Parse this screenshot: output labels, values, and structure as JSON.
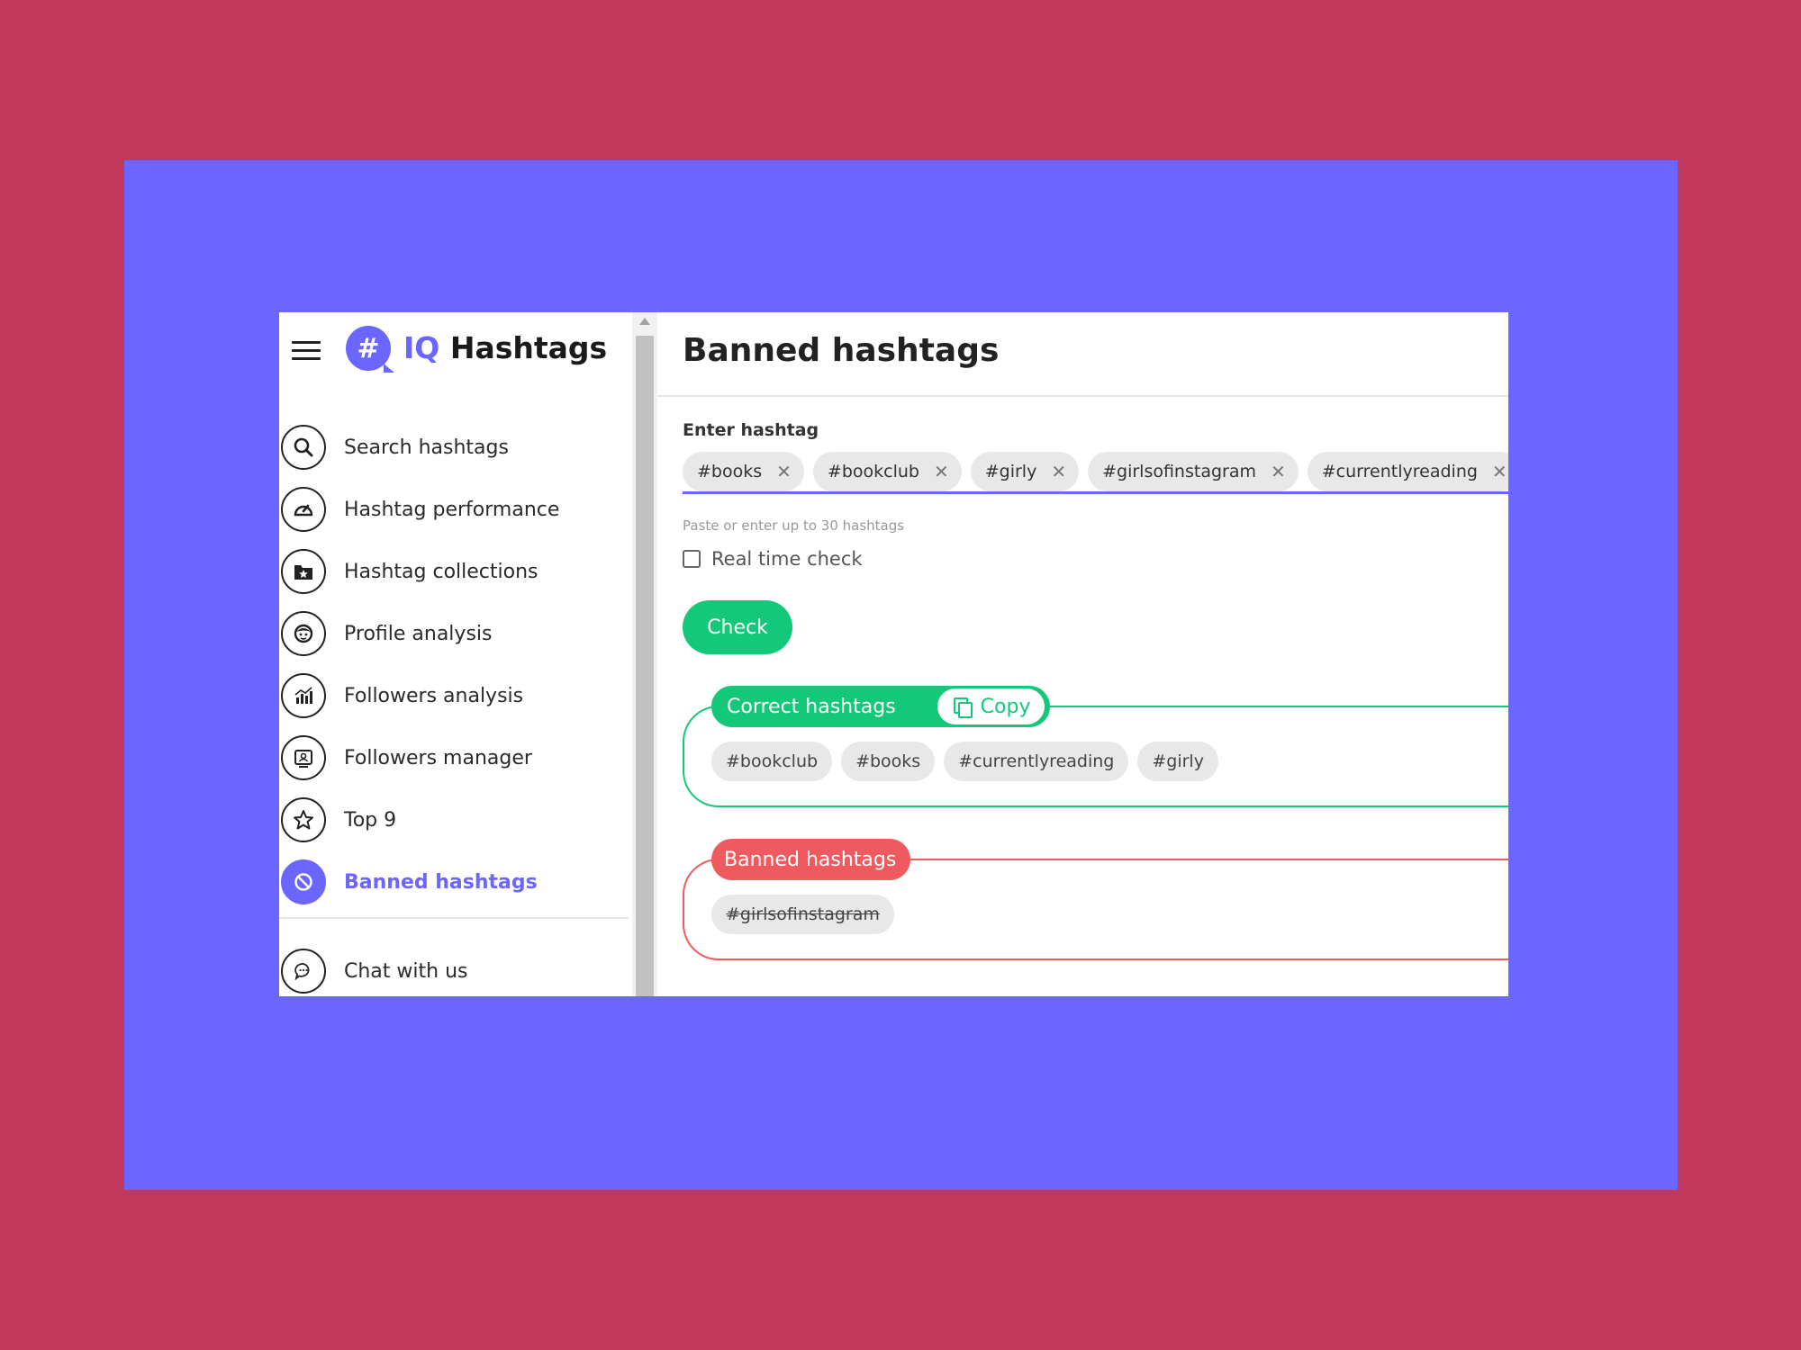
{
  "logo": {
    "badge": "#",
    "prefix": "IQ",
    "name": "Hashtags"
  },
  "colors": {
    "background": "#c0395d",
    "frame": "#6b66ff",
    "accent": "#6b66ff",
    "success": "#13c979",
    "danger": "#ef5a5f"
  },
  "sidebar": {
    "items": [
      {
        "label": "Search hashtags",
        "icon": "search-icon"
      },
      {
        "label": "Hashtag performance",
        "icon": "speedometer-icon"
      },
      {
        "label": "Hashtag collections",
        "icon": "folder-star-icon"
      },
      {
        "label": "Profile analysis",
        "icon": "face-icon"
      },
      {
        "label": "Followers analysis",
        "icon": "bar-chart-icon"
      },
      {
        "label": "Followers manager",
        "icon": "id-card-icon"
      },
      {
        "label": "Top 9",
        "icon": "star-icon"
      },
      {
        "label": "Banned hashtags",
        "icon": "block-icon",
        "active": true
      },
      {
        "label": "Chat with us",
        "icon": "chat-icon"
      }
    ]
  },
  "main": {
    "title": "Banned hashtags",
    "input": {
      "label": "Enter hashtag",
      "chips": [
        "#books",
        "#bookclub",
        "#girly",
        "#girlsofinstagram",
        "#currentlyreading"
      ],
      "helper": "Paste or enter up to 30 hashtags"
    },
    "realtime_label": "Real time check",
    "realtime_checked": false,
    "check_button": "Check",
    "correct": {
      "title": "Correct hashtags",
      "copy_label": "Copy",
      "tags": [
        "#bookclub",
        "#books",
        "#currentlyreading",
        "#girly"
      ]
    },
    "banned": {
      "title": "Banned hashtags",
      "tags": [
        "#girlsofinstagram"
      ]
    }
  }
}
